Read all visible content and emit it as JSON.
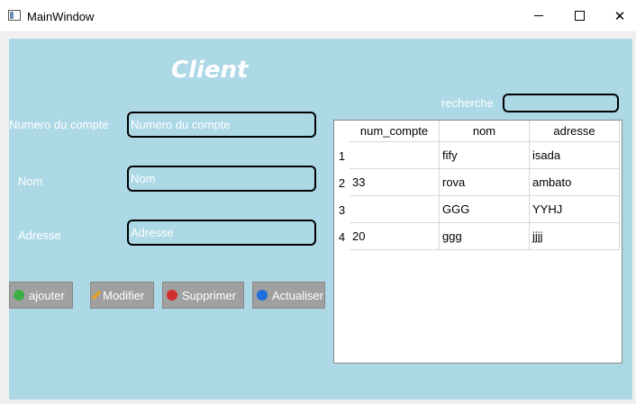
{
  "window": {
    "title": "MainWindow"
  },
  "form": {
    "heading": "Client",
    "fields": [
      {
        "label": "Numero du compte",
        "placeholder": "Numero du compte"
      },
      {
        "label": "Nom",
        "placeholder": "Nom"
      },
      {
        "label": "Adresse",
        "placeholder": "Adresse"
      }
    ]
  },
  "buttons": [
    {
      "label": "ajouter",
      "icon": "add-icon",
      "color": "#3cb043"
    },
    {
      "label": "Modifier",
      "icon": "pencil-icon",
      "color": "#e0a030"
    },
    {
      "label": "Supprimer",
      "icon": "delete-icon",
      "color": "#d32f2f"
    },
    {
      "label": "Actualiser",
      "icon": "refresh-icon",
      "color": "#1e6fd9"
    }
  ],
  "search": {
    "label": "recherche",
    "value": ""
  },
  "table": {
    "headers": [
      "num_compte",
      "nom",
      "adresse"
    ],
    "rows": [
      {
        "index": "1",
        "cells": [
          "",
          "fify",
          "isada"
        ]
      },
      {
        "index": "2",
        "cells": [
          "33",
          "rova",
          "ambato"
        ]
      },
      {
        "index": "3",
        "cells": [
          "",
          "GGG",
          "YYHJ"
        ]
      },
      {
        "index": "4",
        "cells": [
          "20",
          "ggg",
          "jjjj"
        ]
      }
    ]
  },
  "colors": {
    "panel": "#add8e6",
    "button": "#a0a0a0"
  }
}
